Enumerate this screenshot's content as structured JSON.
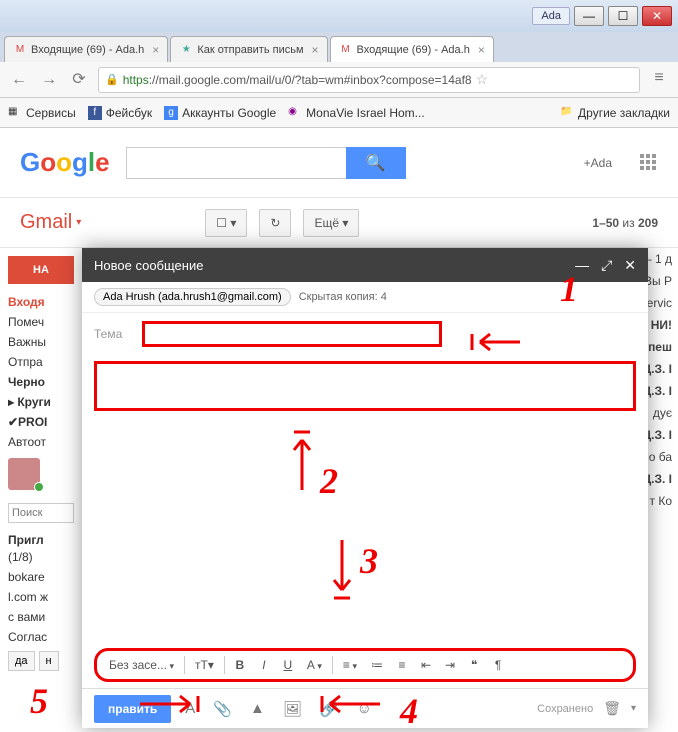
{
  "window": {
    "user": "Ada",
    "min": "—",
    "max": "☐",
    "close": "✕"
  },
  "tabs": [
    {
      "icon": "M",
      "label": "Входящие (69) - Ada.h",
      "active": false
    },
    {
      "icon": "☆",
      "label": "Как отправить письм",
      "active": false
    },
    {
      "icon": "M",
      "label": "Входящие (69) - Ada.h",
      "active": true
    }
  ],
  "url": {
    "https": "https",
    "rest": "://mail.google.com/mail/u/0/?tab=wm#inbox?compose=14af8"
  },
  "bookmarks": {
    "apps": "Сервисы",
    "items": [
      "Фейсбук",
      "Аккаунты Google",
      "MonaVie Israel Hom..."
    ],
    "other": "Другие закладки"
  },
  "google": {
    "search_placeholder": "",
    "plus": "+Ada"
  },
  "gmail": {
    "label": "Gmail",
    "btn_select": "☐ ▾",
    "btn_refresh": "↻",
    "btn_more": "Ещё ▾",
    "count_prefix": "1–50",
    "count_mid": " из ",
    "count_total": "209"
  },
  "sidebar": {
    "compose": "НА",
    "items": [
      {
        "label": "Входя",
        "cls": "active"
      },
      {
        "label": "Помеч",
        "cls": ""
      },
      {
        "label": "Важны",
        "cls": ""
      },
      {
        "label": "Отпра",
        "cls": ""
      },
      {
        "label": "Черно",
        "cls": "bold"
      },
      {
        "label": "▸ Круги",
        "cls": "bold"
      },
      {
        "label": "✔PROI",
        "cls": "bold"
      },
      {
        "label": "Автоот",
        "cls": ""
      }
    ],
    "search_ph": "Поиск",
    "invite_title": "Пригл",
    "invite_count": "(1/8)",
    "invite_text": [
      "bokare",
      "l.com ж",
      "с вами",
      "Соглас"
    ],
    "btn_yes": "да",
    "btn_no": "н"
  },
  "content_snippets": [
    "– 1 д",
    "Вы Р",
    "",
    "",
    "ervic",
    "НИ!",
    "пеш",
    "Ц.З. І",
    "Ц.З. І",
    "дує",
    "",
    "Ц.З. І",
    "о ба",
    "Ц.З. І",
    "т Ко"
  ],
  "compose": {
    "title": "Новое сообщение",
    "min": "—",
    "pop": "⤢",
    "close": "✕",
    "chip": "Ada Hrush (ada.hrush1@gmail.com)",
    "bcc": "Скрытая копия: 4",
    "subject_label": "Тема",
    "font": "Без засе...",
    "size": "тT▾",
    "bold": "B",
    "italic": "I",
    "underline": "U",
    "color": "A",
    "align": "≡",
    "numlist": "≔",
    "bullist": "≡",
    "outdent": "⇤",
    "indent": "⇥",
    "quote": "❝",
    "rtl": "¶",
    "send": "править",
    "fmt_a": "A",
    "attach": "📎",
    "drive": "▲",
    "photo": "🖼",
    "link": "🔗",
    "emoji": "☺",
    "saved": "Сохранено",
    "trash": "🗑",
    "more": "▾"
  },
  "annotations": {
    "n1": "1",
    "n2": "2",
    "n3": "3",
    "n4": "4",
    "n5": "5"
  }
}
